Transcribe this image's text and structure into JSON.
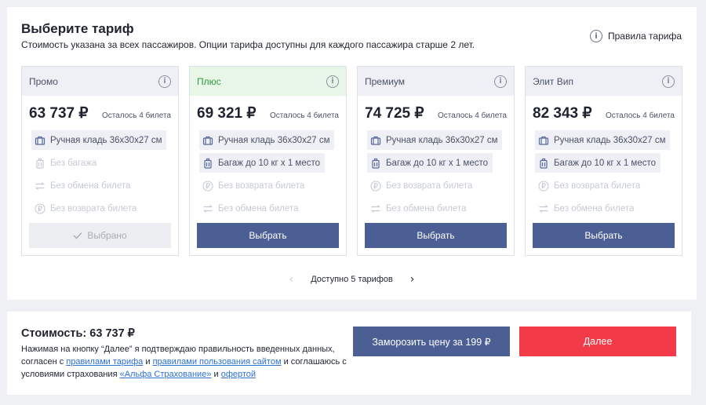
{
  "header": {
    "title": "Выберите тариф",
    "subtitle": "Стоимость указана за всех пассажиров. Опции тарифа доступны для каждого пассажира старше 2 лет.",
    "rules_link": "Правила тарифа"
  },
  "cards": [
    {
      "name": "Промо",
      "price": "63 737 ₽",
      "left": "Осталось 4 билета",
      "options": [
        {
          "label": "Ручная кладь 36x30x27 см",
          "icon": "bag-icon",
          "on": true
        },
        {
          "label": "Без багажа",
          "icon": "luggage-icon",
          "on": false
        },
        {
          "label": "Без обмена билета",
          "icon": "exchange-icon",
          "on": false
        },
        {
          "label": "Без возврата билета",
          "icon": "ruble-icon",
          "on": false
        }
      ],
      "button": "Выбрано",
      "selected": true
    },
    {
      "name": "Плюс",
      "price": "69 321 ₽",
      "left": "Осталось 4 билета",
      "options": [
        {
          "label": "Ручная кладь 36x30x27 см",
          "icon": "bag-icon",
          "on": true
        },
        {
          "label": "Багаж до 10 кг х 1 место",
          "icon": "luggage-icon",
          "on": true
        },
        {
          "label": "Без возврата билета",
          "icon": "ruble-icon",
          "on": false
        },
        {
          "label": "Без обмена билета",
          "icon": "exchange-icon",
          "on": false
        }
      ],
      "button": "Выбрать",
      "selected": false
    },
    {
      "name": "Премиум",
      "price": "74 725 ₽",
      "left": "Осталось 4 билета",
      "options": [
        {
          "label": "Ручная кладь 36x30x27 см",
          "icon": "bag-icon",
          "on": true
        },
        {
          "label": "Багаж до 10 кг х 1 место",
          "icon": "luggage-icon",
          "on": true
        },
        {
          "label": "Без возврата билета",
          "icon": "ruble-icon",
          "on": false
        },
        {
          "label": "Без обмена билета",
          "icon": "exchange-icon",
          "on": false
        }
      ],
      "button": "Выбрать",
      "selected": false
    },
    {
      "name": "Элит Вип",
      "price": "82 343 ₽",
      "left": "Осталось 4 билета",
      "options": [
        {
          "label": "Ручная кладь 36x30x27 см",
          "icon": "bag-icon",
          "on": true
        },
        {
          "label": "Багаж до 10 кг х 1 место",
          "icon": "luggage-icon",
          "on": true
        },
        {
          "label": "Без возврата билета",
          "icon": "ruble-icon",
          "on": false
        },
        {
          "label": "Без обмена билета",
          "icon": "exchange-icon",
          "on": false
        }
      ],
      "button": "Выбрать",
      "selected": false
    }
  ],
  "pager": {
    "label": "Доступно 5 тарифов"
  },
  "footer": {
    "cost": "Стоимость: 63 737 ₽",
    "consent_1": "Нажимая на кнопку “Далее” я подтверждаю правильность введенных данных, согласен с ",
    "link_tariff": "правилами тарифа",
    "consent_2": " и ",
    "link_site": "правилами пользования сайтом",
    "consent_3": " и соглашаюсь с условиями страхования ",
    "link_insurance": "«Альфа Страхование»",
    "consent_4": " и ",
    "link_offer": "офертой",
    "freeze_button": "Заморозить цену за 199 ₽",
    "next_button": "Далее"
  },
  "colors": {
    "primary": "#4c5f95",
    "danger": "#f23a48",
    "green": "#2e9a3d",
    "link": "#2c6fd0"
  }
}
